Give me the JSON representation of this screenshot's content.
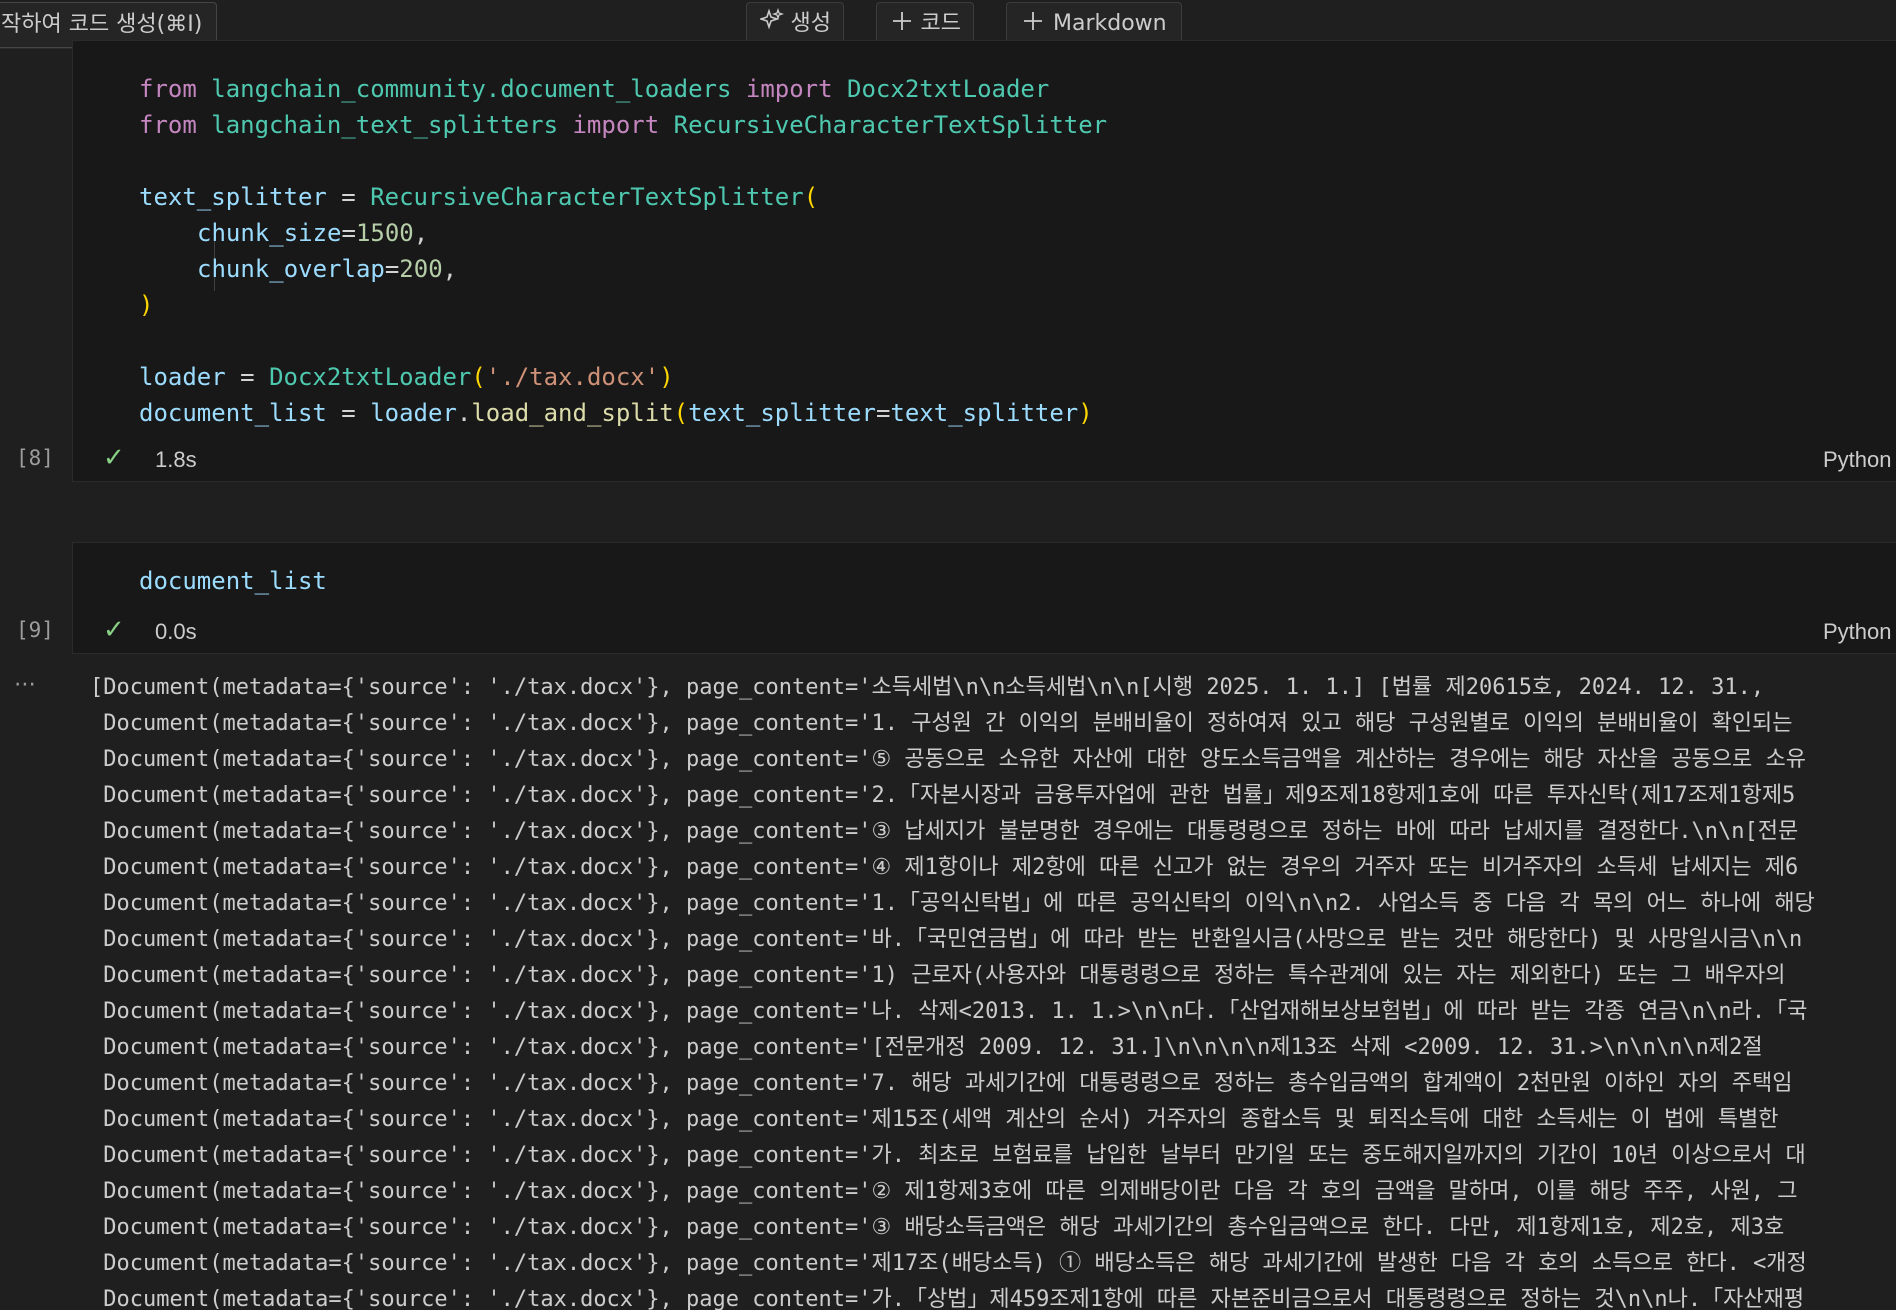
{
  "toolbar": {
    "hint_label": "작하여 코드 생성(⌘I)",
    "generate_label": "생성",
    "add_code_label": "코드",
    "add_markdown_label": "Markdown",
    "generate_icon": "sparkle-icon",
    "add_icon": "plus-icon"
  },
  "cell1": {
    "exec_count": "[8]",
    "status_icon": "check-icon",
    "duration": "1.8s",
    "language": "Python",
    "code": {
      "l1_from": "from",
      "l1_mod": "langchain_community.document_loaders",
      "l1_import": "import",
      "l1_cls": "Docx2txtLoader",
      "l2_from": "from",
      "l2_mod": "langchain_text_splitters",
      "l2_import": "import",
      "l2_cls": "RecursiveCharacterTextSplitter",
      "l4_var": "text_splitter",
      "l4_eq": " = ",
      "l4_cls": "RecursiveCharacterTextSplitter",
      "l4_paren": "(",
      "l5_param": "chunk_size",
      "l5_eq": "=",
      "l5_num": "1500",
      "l5_comma": ",",
      "l6_param": "chunk_overlap",
      "l6_eq": "=",
      "l6_num": "200",
      "l6_comma": ",",
      "l7_paren": ")",
      "l9_var": "loader",
      "l9_eq": " = ",
      "l9_cls": "Docx2txtLoader",
      "l9_open": "(",
      "l9_str": "'./tax.docx'",
      "l9_close": ")",
      "l10_var": "document_list",
      "l10_eq": " = ",
      "l10_obj": "loader",
      "l10_dot": ".",
      "l10_fn": "load_and_split",
      "l10_open": "(",
      "l10_param": "text_splitter",
      "l10_eq2": "=",
      "l10_arg": "text_splitter",
      "l10_close": ")"
    }
  },
  "cell2": {
    "exec_count": "[9]",
    "status_icon": "check-icon",
    "duration": "0.0s",
    "language": "Python",
    "code": "document_list"
  },
  "output": {
    "more_icon": "ellipsis-icon",
    "lines": [
      "[Document(metadata={'source': './tax.docx'}, page_content='소득세법\\n\\n소득세법\\n\\n[시행 2025. 1. 1.] [법률 제20615호, 2024. 12. 31.,",
      " Document(metadata={'source': './tax.docx'}, page_content='1. 구성원 간 이익의 분배비율이 정하여져 있고 해당 구성원별로 이익의 분배비율이 확인되는",
      " Document(metadata={'source': './tax.docx'}, page_content='⑤ 공동으로 소유한 자산에 대한 양도소득금액을 계산하는 경우에는 해당 자산을 공동으로 소유",
      " Document(metadata={'source': './tax.docx'}, page_content='2.「자본시장과 금융투자업에 관한 법률」제9조제18항제1호에 따른 투자신탁(제17조제1항제5",
      " Document(metadata={'source': './tax.docx'}, page_content='③ 납세지가 불분명한 경우에는 대통령령으로 정하는 바에 따라 납세지를 결정한다.\\n\\n[전문",
      " Document(metadata={'source': './tax.docx'}, page_content='④ 제1항이나 제2항에 따른 신고가 없는 경우의 거주자 또는 비거주자의 소득세 납세지는 제6",
      " Document(metadata={'source': './tax.docx'}, page_content='1.「공익신탁법」에 따른 공익신탁의 이익\\n\\n2. 사업소득 중 다음 각 목의 어느 하나에 해당",
      " Document(metadata={'source': './tax.docx'}, page_content='바.「국민연금법」에 따라 받는 반환일시금(사망으로 받는 것만 해당한다) 및 사망일시금\\n\\n",
      " Document(metadata={'source': './tax.docx'}, page_content='1) 근로자(사용자와 대통령령으로 정하는 특수관계에 있는 자는 제외한다) 또는 그 배우자의",
      " Document(metadata={'source': './tax.docx'}, page_content='나. 삭제<2013. 1. 1.>\\n\\n다.「산업재해보상보험법」에 따라 받는 각종 연금\\n\\n라.「국",
      " Document(metadata={'source': './tax.docx'}, page_content='[전문개정 2009. 12. 31.]\\n\\n\\n\\n제13조 삭제 <2009. 12. 31.>\\n\\n\\n\\n제2절",
      " Document(metadata={'source': './tax.docx'}, page_content='7. 해당 과세기간에 대통령령으로 정하는 총수입금액의 합계액이 2천만원 이하인 자의 주택임",
      " Document(metadata={'source': './tax.docx'}, page_content='제15조(세액 계산의 순서) 거주자의 종합소득 및 퇴직소득에 대한 소득세는 이 법에 특별한",
      " Document(metadata={'source': './tax.docx'}, page_content='가. 최초로 보험료를 납입한 날부터 만기일 또는 중도해지일까지의 기간이 10년 이상으로서 대",
      " Document(metadata={'source': './tax.docx'}, page_content='② 제1항제3호에 따른 의제배당이란 다음 각 호의 금액을 말하며, 이를 해당 주주, 사원, 그",
      " Document(metadata={'source': './tax.docx'}, page_content='③ 배당소득금액은 해당 과세기간의 총수입금액으로 한다. 다만, 제1항제1호, 제2호, 제3호",
      " Document(metadata={'source': './tax.docx'}, page_content='제17조(배당소득) ① 배당소득은 해당 과세기간에 발생한 다음 각 호의 소득으로 한다. <개정",
      " Document(metadata={'source': './tax.docx'}, page_content='가.「상법」제459조제1항에 따른 자본준비금으로서 대통령령으로 정하는 것\\n\\n나.「자산재평"
    ]
  }
}
